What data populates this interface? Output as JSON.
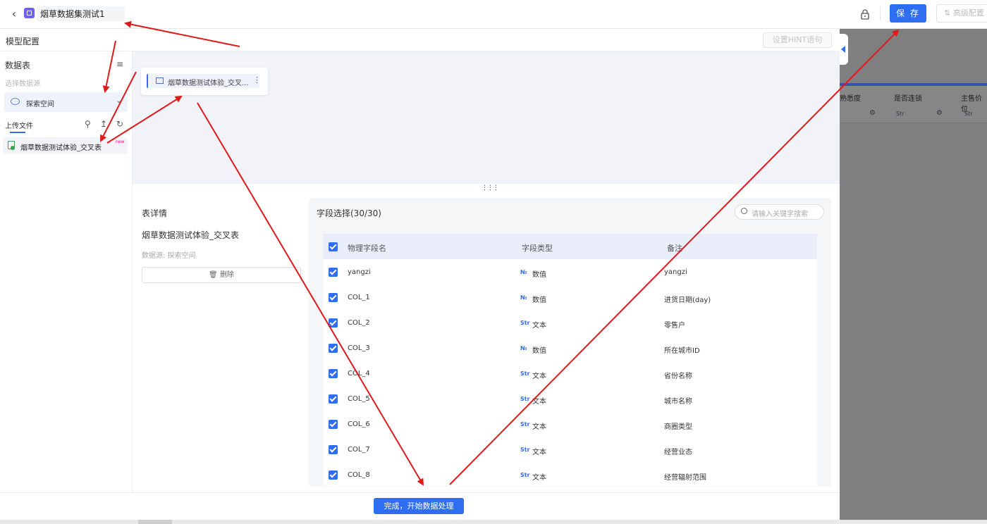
{
  "header": {
    "back_icon": "chevron-left-icon",
    "title_value": "烟草数据集测试1",
    "save_label": "保 存",
    "advanced_label": "高级配置"
  },
  "model_config": {
    "title": "模型配置",
    "hint_button": "设置HINT语句"
  },
  "sidebar": {
    "title": "数据表",
    "source_placeholder": "选择数据源",
    "source_selected": "探索空间",
    "upload_tab": "上传文件",
    "file_item": "烟草数据测试体验_交叉表",
    "file_badge": "new"
  },
  "canvas": {
    "node_label": "烟草数据测试体验_交叉..."
  },
  "detail": {
    "title": "表详情",
    "table_name": "烟草数据测试体验_交叉表",
    "source_line": "数据源:  探索空间",
    "delete_label": "删除"
  },
  "fields": {
    "title": "字段选择(30/30)",
    "search_placeholder": "请输入关键字搜索",
    "columns": [
      "物理字段名",
      "字段类型",
      "备注"
    ],
    "rows": [
      {
        "name": "yangzi",
        "type_tag": "№",
        "type": "数值",
        "note": "yangzi"
      },
      {
        "name": "COL_1",
        "type_tag": "№",
        "type": "数值",
        "note": "进货日期(day)"
      },
      {
        "name": "COL_2",
        "type_tag": "Str",
        "type": "文本",
        "note": "零售户"
      },
      {
        "name": "COL_3",
        "type_tag": "№",
        "type": "数值",
        "note": "所在城市ID"
      },
      {
        "name": "COL_4",
        "type_tag": "Str",
        "type": "文本",
        "note": "省份名称"
      },
      {
        "name": "COL_5",
        "type_tag": "Str",
        "type": "文本",
        "note": "城市名称"
      },
      {
        "name": "COL_6",
        "type_tag": "Str",
        "type": "文本",
        "note": "商圈类型"
      },
      {
        "name": "COL_7",
        "type_tag": "Str",
        "type": "文本",
        "note": "经营业态"
      },
      {
        "name": "COL_8",
        "type_tag": "Str",
        "type": "文本",
        "note": "经营辐射范围"
      }
    ]
  },
  "background_table": {
    "headers": [
      "熟悉度",
      "是否连锁",
      "主售价位"
    ],
    "tags": [
      "Str",
      "Str"
    ]
  },
  "footer": {
    "done_label": "完成，开始数据处理"
  },
  "colors": {
    "primary": "#2f6ef0",
    "annotation_arrow": "#e0191b",
    "overlay": "#7f7f7f"
  }
}
